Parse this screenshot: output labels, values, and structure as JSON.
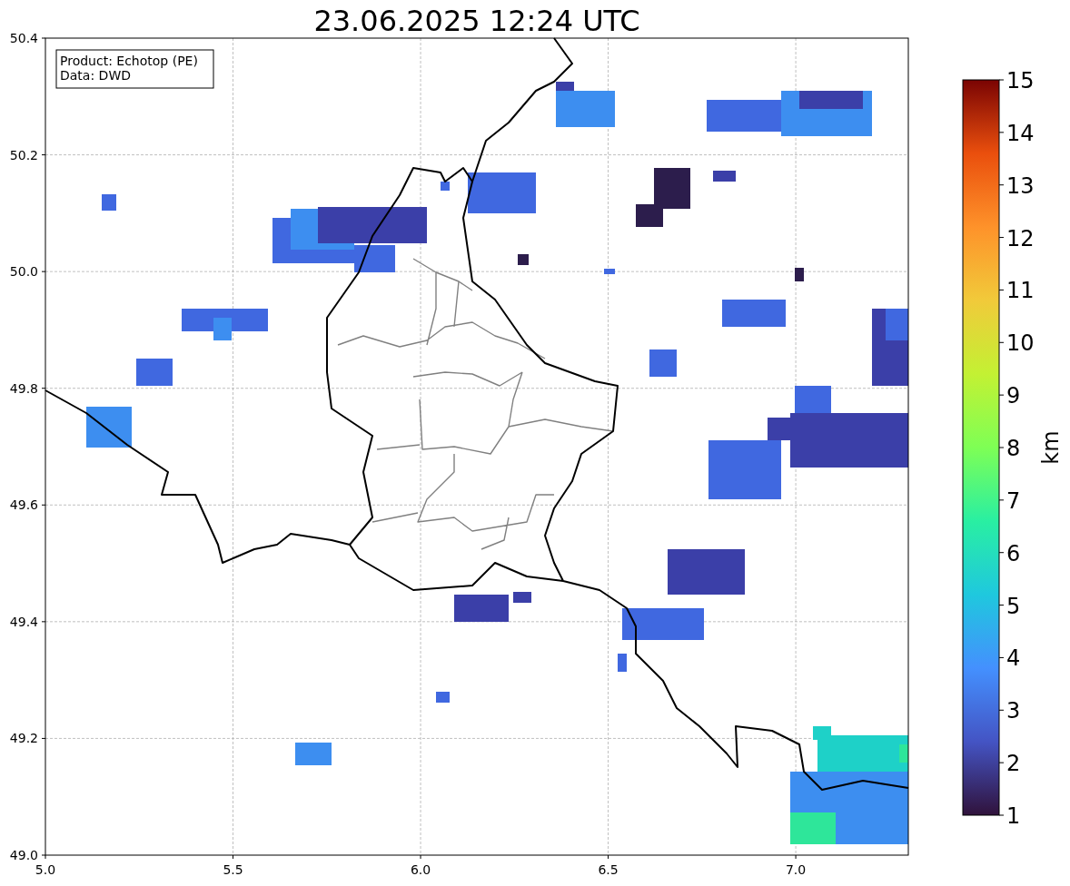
{
  "title": "23.06.2025 12:24 UTC",
  "info_box": [
    "Product: Echotop (PE)",
    "Data: DWD"
  ],
  "map": {
    "x_tick_labels": [
      "5.0",
      "5.5",
      "6.0",
      "6.5",
      "7.0"
    ],
    "y_tick_labels": [
      "50.4",
      "50.2",
      "50.0",
      "49.8",
      "49.6",
      "49.4",
      "49.2",
      "49.0"
    ]
  },
  "colorbar": {
    "label": "km",
    "tick_labels": [
      "15",
      "14",
      "13",
      "12",
      "11",
      "10",
      "9",
      "8",
      "7",
      "6",
      "5",
      "4",
      "3",
      "2",
      "1"
    ]
  }
}
